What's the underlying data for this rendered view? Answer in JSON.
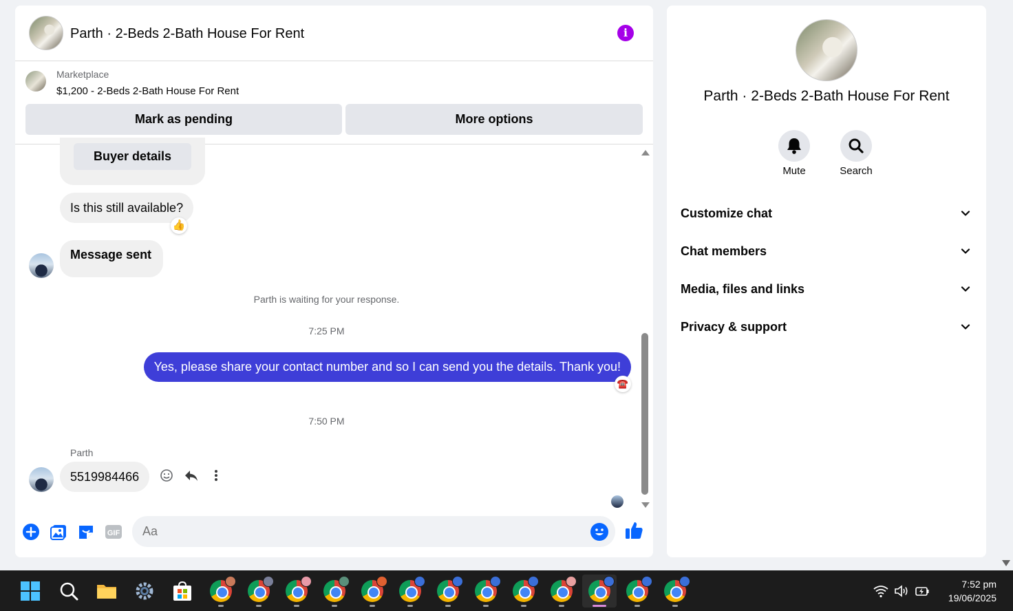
{
  "chat": {
    "title": "Parth · 2-Beds 2-Bath House For Rent",
    "listing": {
      "label": "Marketplace",
      "price_title": "$1,200 - 2-Beds 2-Bath House For Rent",
      "mark_pending_label": "Mark as pending",
      "more_options_label": "More options"
    },
    "messages": {
      "buyer_details_label": "Buyer details",
      "first_message": "Is this still available?",
      "first_reaction": "👍",
      "message_sent": "Message sent",
      "waiting_notice": "Parth is waiting for your response.",
      "time_1": "7:25 PM",
      "outgoing_message": "Yes, please share your contact number and so I can send you the details. Thank you!",
      "outgoing_reaction": "☎️",
      "time_2": "7:50 PM",
      "sender_name": "Parth",
      "last_message": "5519984466"
    },
    "composer": {
      "placeholder": "Aa"
    }
  },
  "info_panel": {
    "title": "Parth · 2-Beds 2-Bath House For Rent",
    "mute_label": "Mute",
    "search_label": "Search",
    "sections": [
      {
        "label": "Customize chat"
      },
      {
        "label": "Chat members"
      },
      {
        "label": "Media, files and links"
      },
      {
        "label": "Privacy & support"
      }
    ]
  },
  "taskbar": {
    "time": "7:52 pm",
    "date": "19/06/2025"
  },
  "colors": {
    "accent": "#0866ff",
    "outgoing_bubble": "#3e3ed8",
    "info_icon": "#a500e8"
  }
}
